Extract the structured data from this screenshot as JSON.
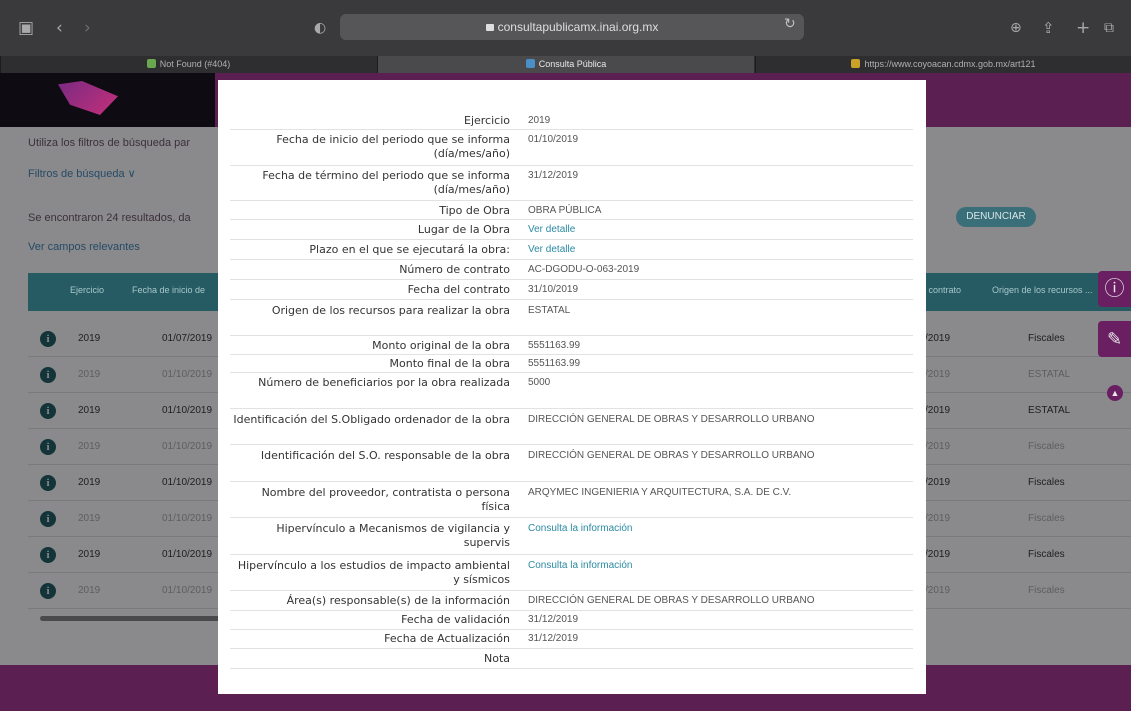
{
  "browser": {
    "url": "consultapublicamx.inai.org.mx",
    "tabs": [
      {
        "title": "Not Found (#404)"
      },
      {
        "title": "Consulta Pública"
      },
      {
        "title": "https://www.coyoacan.cdmx.gob.mx/art121"
      }
    ]
  },
  "background": {
    "intro_text": "Utiliza los filtros de búsqueda par",
    "filters_link": "Filtros de búsqueda ∨",
    "results_text": "Se encontraron 24 resultados, da",
    "relevant_fields_link": "Ver campos relevantes",
    "denounce_button": "DENUNCIAR",
    "table_headers": {
      "ejercicio": "Ejercicio",
      "fecha_inicio": "Fecha de inicio de",
      "contrato": "l contrato",
      "origen": "Origen de los recursos ..."
    },
    "rows": [
      {
        "year": "2019",
        "date": "01/07/2019",
        "contract_date": "/2019",
        "origin": "Fiscales"
      },
      {
        "year": "2019",
        "date": "01/10/2019",
        "contract_date": "/2019",
        "origin": "ESTATAL"
      },
      {
        "year": "2019",
        "date": "01/10/2019",
        "contract_date": "/2019",
        "origin": "ESTATAL"
      },
      {
        "year": "2019",
        "date": "01/10/2019",
        "contract_date": "/2019",
        "origin": "Fiscales"
      },
      {
        "year": "2019",
        "date": "01/10/2019",
        "contract_date": "/2019",
        "origin": "Fiscales"
      },
      {
        "year": "2019",
        "date": "01/10/2019",
        "contract_date": "/2019",
        "origin": "Fiscales"
      },
      {
        "year": "2019",
        "date": "01/10/2019",
        "contract_date": "/2019",
        "origin": "Fiscales"
      },
      {
        "year": "2019",
        "date": "01/10/2019",
        "contract_date": "/2019",
        "origin": "Fiscales"
      }
    ]
  },
  "detail": [
    {
      "label": "Ejercicio",
      "value": "2019",
      "link": false
    },
    {
      "label": "Fecha de inicio del periodo que se informa (día/mes/año)",
      "value": "01/10/2019",
      "link": false
    },
    {
      "label": "Fecha de término del periodo que se informa (día/mes/año)",
      "value": "31/12/2019",
      "link": false
    },
    {
      "label": "Tipo de Obra",
      "value": "OBRA PÚBLICA",
      "link": false
    },
    {
      "label": "Lugar de la Obra",
      "value": "Ver detalle",
      "link": true
    },
    {
      "label": "Plazo en el que se ejecutará la obra:",
      "value": "Ver detalle",
      "link": true
    },
    {
      "label": "Número de contrato",
      "value": "AC-DGODU-O-063-2019",
      "link": false
    },
    {
      "label": "Fecha del contrato",
      "value": "31/10/2019",
      "link": false
    },
    {
      "label": "Origen de los recursos para realizar la obra",
      "value": "ESTATAL",
      "link": false
    },
    {
      "label": "Monto original de la obra",
      "value": "5551163.99",
      "link": false
    },
    {
      "label": "Monto final de la obra",
      "value": "5551163.99",
      "link": false
    },
    {
      "label": "Número de beneficiarios por la obra realizada",
      "value": "5000",
      "link": false
    },
    {
      "label": "Identificación del S.Obligado ordenador de la obra",
      "value": "DIRECCIÓN GENERAL DE OBRAS Y DESARROLLO URBANO",
      "link": false
    },
    {
      "label": "Identificación del S.O. responsable de la obra",
      "value": "DIRECCIÓN GENERAL DE OBRAS Y DESARROLLO URBANO",
      "link": false
    },
    {
      "label": "Nombre del proveedor, contratista o persona física",
      "value": "ARQYMEC INGENIERIA Y ARQUITECTURA, S.A. DE C.V.",
      "link": false
    },
    {
      "label": "Hipervínculo a Mecanismos de vigilancia y supervis",
      "value": "Consulta la información",
      "link": true
    },
    {
      "label": "Hipervínculo a los estudios de impacto ambiental y sísmicos",
      "value": "Consulta la información",
      "link": true
    },
    {
      "label": "Área(s) responsable(s) de la información",
      "value": "DIRECCIÓN GENERAL DE OBRAS Y DESARROLLO URBANO",
      "link": false
    },
    {
      "label": "Fecha de validación",
      "value": "31/12/2019",
      "link": false
    },
    {
      "label": "Fecha de Actualización",
      "value": "31/12/2019",
      "link": false
    },
    {
      "label": "Nota",
      "value": "",
      "link": false
    }
  ],
  "colors": {
    "brand": "#5c1f52",
    "table_header": "#265b63",
    "link": "#2a8aa3"
  }
}
